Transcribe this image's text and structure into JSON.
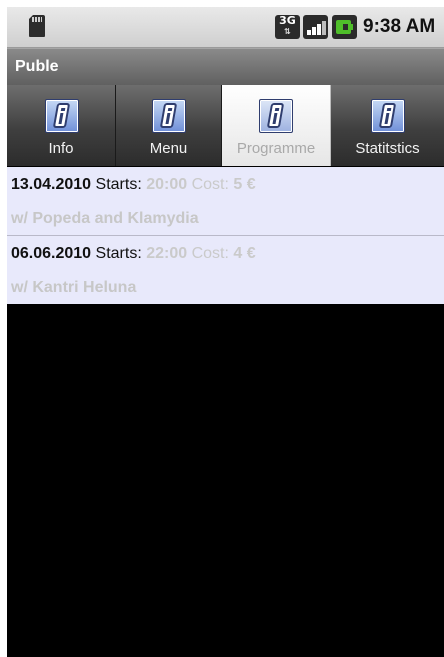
{
  "status_bar": {
    "network_badge": "3G",
    "time": "9:38 AM",
    "icons": [
      "sd-card-icon",
      "network-3g-icon",
      "signal-strength-icon",
      "battery-charging-icon"
    ]
  },
  "app": {
    "title": "Puble"
  },
  "tabs": [
    {
      "label": "Info",
      "icon": "info-icon",
      "selected": false
    },
    {
      "label": "Menu",
      "icon": "info-icon",
      "selected": false
    },
    {
      "label": "Programme",
      "icon": "info-icon",
      "selected": true
    },
    {
      "label": "Statitstics",
      "icon": "info-icon",
      "selected": false
    }
  ],
  "events": [
    {
      "date": "13.04.2010",
      "starts_label": "Starts:",
      "start_time": "20:00",
      "cost_label": "Cost:",
      "cost_value": "5 €",
      "with_text": "w/ Popeda and Klamydia"
    },
    {
      "date": "06.06.2010",
      "starts_label": "Starts:",
      "start_time": "22:00",
      "cost_label": "Cost:",
      "cost_value": "4 €",
      "with_text": "w/ Kantri Heluna"
    }
  ],
  "colors": {
    "status_bar": "#d9d9d9",
    "title_bar": "#707070",
    "list_background": "#e8e9fb",
    "muted_text": "#cacaca",
    "battery": "#4fbf2a",
    "info_icon": "#6f8fd8"
  }
}
